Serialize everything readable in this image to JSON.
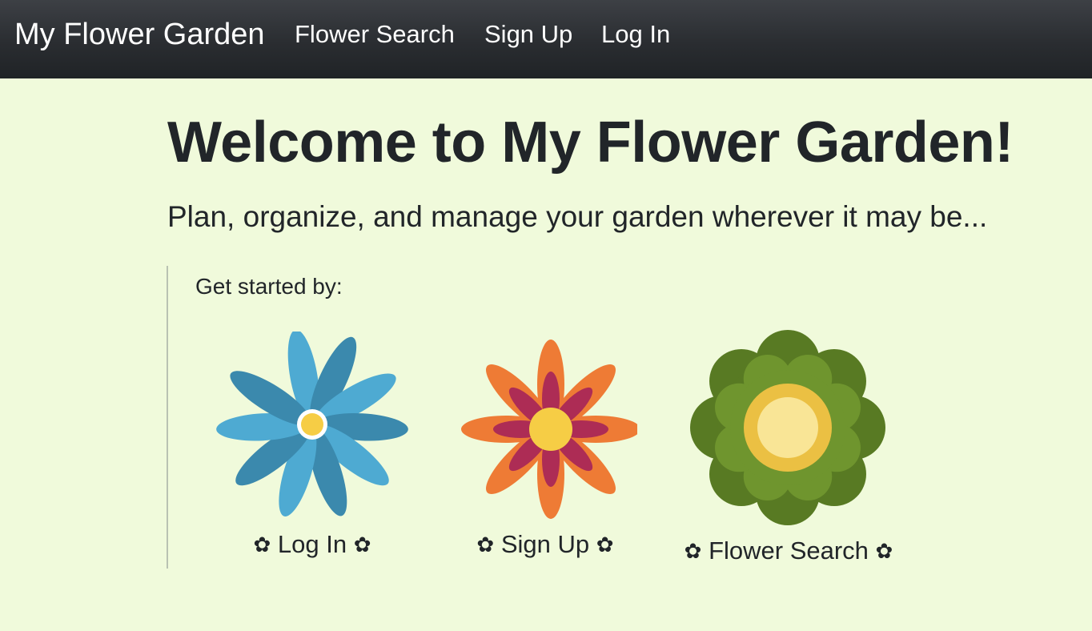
{
  "navbar": {
    "brand": "My Flower Garden",
    "links": [
      {
        "label": "Flower Search"
      },
      {
        "label": "Sign Up"
      },
      {
        "label": "Log In"
      }
    ]
  },
  "hero": {
    "title": "Welcome to My Flower Garden!",
    "subtitle": "Plan, organize, and manage your garden wherever it may be..."
  },
  "get_started": {
    "heading": "Get started by:",
    "decoration": "✿",
    "options": [
      {
        "label": "Log In",
        "icon": "blue-flower-icon"
      },
      {
        "label": "Sign Up",
        "icon": "orange-flower-icon"
      },
      {
        "label": "Flower Search",
        "icon": "green-flower-icon"
      }
    ]
  },
  "colors": {
    "page_background": "#f0fadb",
    "navbar": "#2a2d31",
    "text": "#212529",
    "blue_petal_light": "#4eaad2",
    "blue_petal_dark": "#3b89ad",
    "orange_petal": "#ee7b35",
    "crimson_petal": "#ad2c55",
    "flower_center": "#f6cd45",
    "green_outer": "#587a23",
    "green_inner": "#6f952e"
  }
}
